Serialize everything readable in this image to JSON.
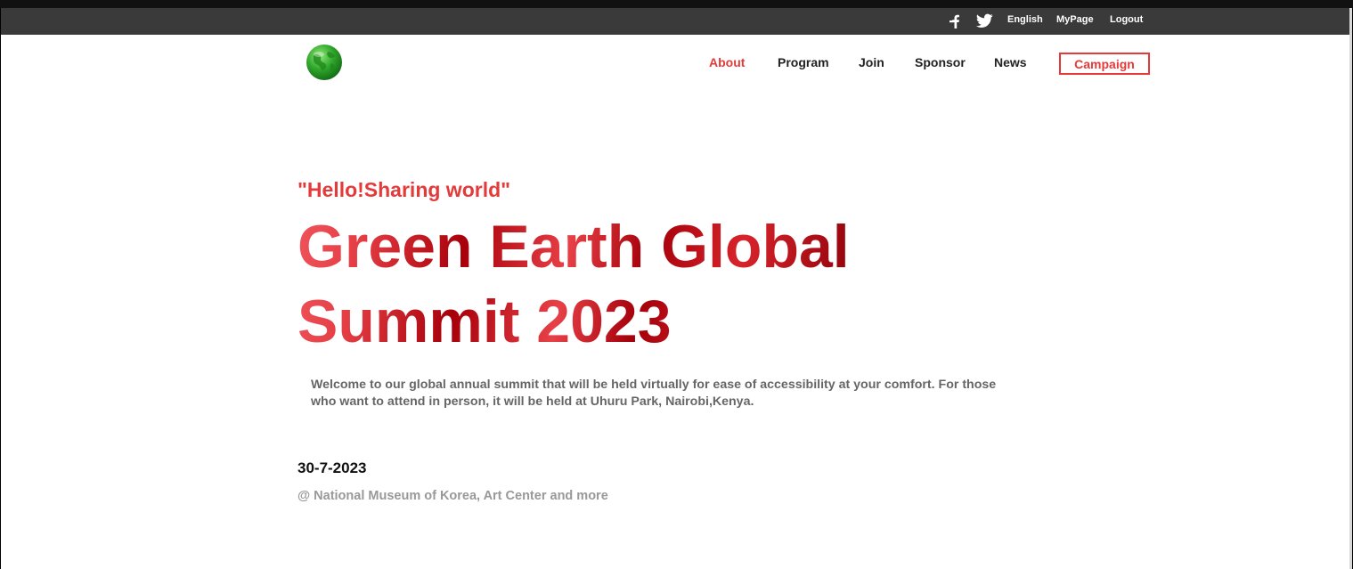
{
  "utility_bar": {
    "icons": [
      "facebook-icon",
      "twitter-icon"
    ],
    "language": "English",
    "mypage": "MyPage",
    "logout": "Logout"
  },
  "header": {
    "logo": "green-globe-logo",
    "nav": {
      "about": "About",
      "program": "Program",
      "join": "Join",
      "sponsor": "Sponsor",
      "news": "News",
      "campaign": "Campaign"
    },
    "active_item": "About"
  },
  "hero": {
    "tagline": "\"Hello!Sharing world\"",
    "title_line1": "Green Earth Global",
    "title_line2": "Summit 2023",
    "intro": "Welcome to our global annual summit that will be held virtually for ease of accessibility at your comfort. For those who want to attend in person, it will be held at Uhuru Park, Nairobi,Kenya.",
    "date": "30-7-2023",
    "venue": "@ National Museum of Korea, Art Center and more"
  },
  "colors": {
    "accent": "#e53a3a",
    "utility_bar_bg": "#3a3a3a",
    "title_dark": "#a8000a",
    "title_light": "#f0545c"
  }
}
